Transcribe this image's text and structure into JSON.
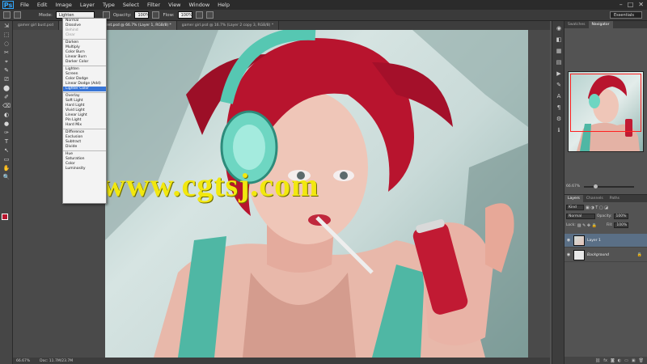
{
  "app": {
    "logo": "Ps"
  },
  "menu": [
    "File",
    "Edit",
    "Image",
    "Layer",
    "Type",
    "Select",
    "Filter",
    "View",
    "Window",
    "Help"
  ],
  "window_controls": [
    "–",
    "□",
    "✕"
  ],
  "options": {
    "mode_label": "Mode:",
    "mode_value": "Lighten",
    "opacity_label": "Opacity:",
    "opacity_value": "100%",
    "flow_label": "Flow:",
    "flow_value": "100%",
    "workspace": "Essentials"
  },
  "blend_modes": {
    "groups": [
      [
        {
          "label": "Normal"
        },
        {
          "label": "Dissolve"
        },
        {
          "label": "Behind",
          "dim": true
        },
        {
          "label": "Clear",
          "dim": true
        }
      ],
      [
        {
          "label": "Darken"
        },
        {
          "label": "Multiply"
        },
        {
          "label": "Color Burn"
        },
        {
          "label": "Linear Burn"
        },
        {
          "label": "Darker Color"
        }
      ],
      [
        {
          "label": "Lighten"
        },
        {
          "label": "Screen"
        },
        {
          "label": "Color Dodge"
        },
        {
          "label": "Linear Dodge (Add)"
        },
        {
          "label": "Lighter Color",
          "selected": true
        }
      ],
      [
        {
          "label": "Overlay"
        },
        {
          "label": "Soft Light"
        },
        {
          "label": "Hard Light"
        },
        {
          "label": "Vivid Light"
        },
        {
          "label": "Linear Light"
        },
        {
          "label": "Pin Light"
        },
        {
          "label": "Hard Mix"
        }
      ],
      [
        {
          "label": "Difference"
        },
        {
          "label": "Exclusion"
        },
        {
          "label": "Subtract"
        },
        {
          "label": "Divide"
        }
      ],
      [
        {
          "label": "Hue"
        },
        {
          "label": "Saturation"
        },
        {
          "label": "Color"
        },
        {
          "label": "Luminosity"
        }
      ]
    ]
  },
  "tabs": [
    {
      "label": "gamer girl bust.psd",
      "active": false
    },
    {
      "label": "gamer girl bust Document.psd @ 66.7% (Layer 1, RGB/8) *",
      "active": true
    },
    {
      "label": "gamer girl.psd @ 16.7% (Layer 2 copy 3, RGB/8) *",
      "active": false
    }
  ],
  "watermark": "www.cgtsj.com",
  "status": {
    "zoom": "66.67%",
    "doc": "Doc: 11.7M/23.7M"
  },
  "panels": {
    "nav_tabs": [
      "Swatches",
      "Navigator"
    ],
    "nav_zoom": "66.67%",
    "layer_tabs": [
      "Layers",
      "Channels",
      "Paths"
    ],
    "kind_label": "Kind",
    "blend_value": "Normal",
    "opacity_label": "Opacity:",
    "opacity_value": "100%",
    "lock_label": "Lock:",
    "fill_label": "Fill:",
    "fill_value": "100%",
    "layers": [
      {
        "name": "Layer 1",
        "active": true,
        "italic": false
      },
      {
        "name": "Background",
        "active": false,
        "italic": true
      }
    ]
  },
  "tools": [
    "⇲",
    "⬚",
    "◌",
    "✂",
    "⌖",
    "✎",
    "⎚",
    "⬤",
    "✐",
    "⌫",
    "◐",
    "●",
    "✑",
    "T",
    "↖",
    "▭",
    "✋",
    "🔍"
  ]
}
